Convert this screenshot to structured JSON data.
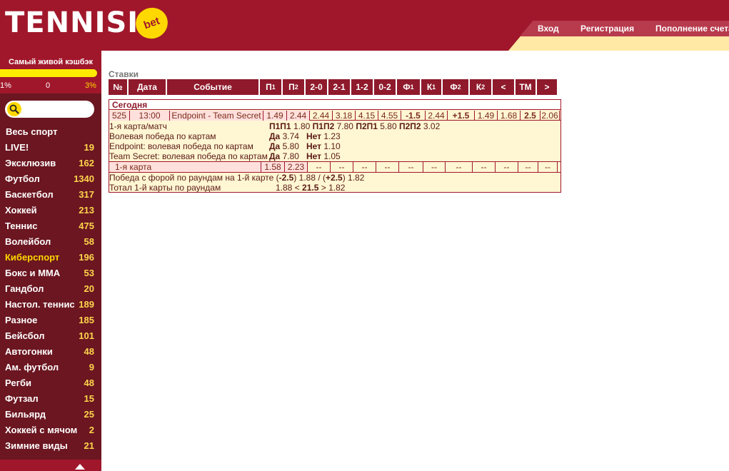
{
  "header": {
    "logo_text": "TENNISI",
    "logo_badge": "bet",
    "nav": [
      "Вход",
      "Регистрация",
      "Пополнение счета"
    ]
  },
  "sidebar": {
    "promo": "Самый живой кэшбэк",
    "cashback_min": "1%",
    "cashback_mid": "0",
    "cashback_max": "3%",
    "search_placeholder": "",
    "all_sport": "Весь спорт",
    "sports": [
      {
        "name": "LIVE!",
        "count": "19"
      },
      {
        "name": "Эксклюзив",
        "count": "162"
      },
      {
        "name": "Футбол",
        "count": "1340"
      },
      {
        "name": "Баскетбол",
        "count": "317"
      },
      {
        "name": "Хоккей",
        "count": "213"
      },
      {
        "name": "Теннис",
        "count": "475"
      },
      {
        "name": "Волейбол",
        "count": "58"
      },
      {
        "name": "Киберспорт",
        "count": "196"
      },
      {
        "name": "Бокс и ММА",
        "count": "53"
      },
      {
        "name": "Гандбол",
        "count": "20"
      },
      {
        "name": "Настол. теннис",
        "count": "189"
      },
      {
        "name": "Разное",
        "count": "185"
      },
      {
        "name": "Бейсбол",
        "count": "101"
      },
      {
        "name": "Автогонки",
        "count": "48"
      },
      {
        "name": "Ам. футбол",
        "count": "9"
      },
      {
        "name": "Регби",
        "count": "48"
      },
      {
        "name": "Футзал",
        "count": "15"
      },
      {
        "name": "Бильярд",
        "count": "25"
      },
      {
        "name": "Хоккей с мячом",
        "count": "2"
      },
      {
        "name": "Зимние виды",
        "count": "21"
      }
    ]
  },
  "main": {
    "section_title": "Ставки",
    "columns": [
      "№",
      "Дата",
      "Событие",
      "П",
      "П",
      "2-0",
      "2-1",
      "1-2",
      "0-2",
      "Ф",
      "К",
      "Ф",
      "К",
      "<",
      "ТМ",
      ">"
    ],
    "col_subs": [
      "",
      "",
      "",
      "1",
      "2",
      "",
      "",
      "",
      "",
      "1",
      "1",
      "2",
      "2",
      "",
      "",
      ""
    ],
    "today": "Сегодня",
    "event": [
      "525",
      "13:00",
      "Endpoint - Team Secret",
      "1.49",
      "2.44",
      "2.44",
      "3.18",
      "4.15",
      "4.55",
      "-1.5",
      "2.44",
      "+1.5",
      "1.49",
      "1.68",
      "2.5",
      "2.06"
    ],
    "lines": {
      "l1_label": "1-я карта/матч",
      "l1_k1": "П1П1",
      "l1_v1": "1.80",
      "l1_k2": "П1П2",
      "l1_v2": "7.80",
      "l1_k3": "П2П1",
      "l1_v3": "5.80",
      "l1_k4": "П2П2",
      "l1_v4": "3.02",
      "l2_label": "Волевая победа по картам",
      "l3_label": "Endpoint: волевая победа по картам",
      "l4_label": "Team Secret: волевая победа по картам",
      "yes": "Да",
      "no": "Нет",
      "l2_yes": "3.74",
      "l2_no": "1.23",
      "l3_yes": "5.80",
      "l3_no": "1.10",
      "l4_yes": "7.80",
      "l4_no": "1.05"
    },
    "map1": [
      "1-я карта",
      "1.58",
      "2.23",
      "--",
      "--",
      "--",
      "--",
      "--",
      "--",
      "--",
      "--",
      "--",
      "--",
      "--"
    ],
    "hcp": {
      "label": "Победа с форой по раундам на 1-й карте (",
      "h1": "-2.5",
      "mid1": ") 1.88 / (",
      "h2": "+2.5",
      "mid2": ") 1.82"
    },
    "total": {
      "label": "Тотал 1-й карты по раундам",
      "under": "1.88 <",
      "line": "21.5",
      "over": "> 1.82"
    }
  }
}
